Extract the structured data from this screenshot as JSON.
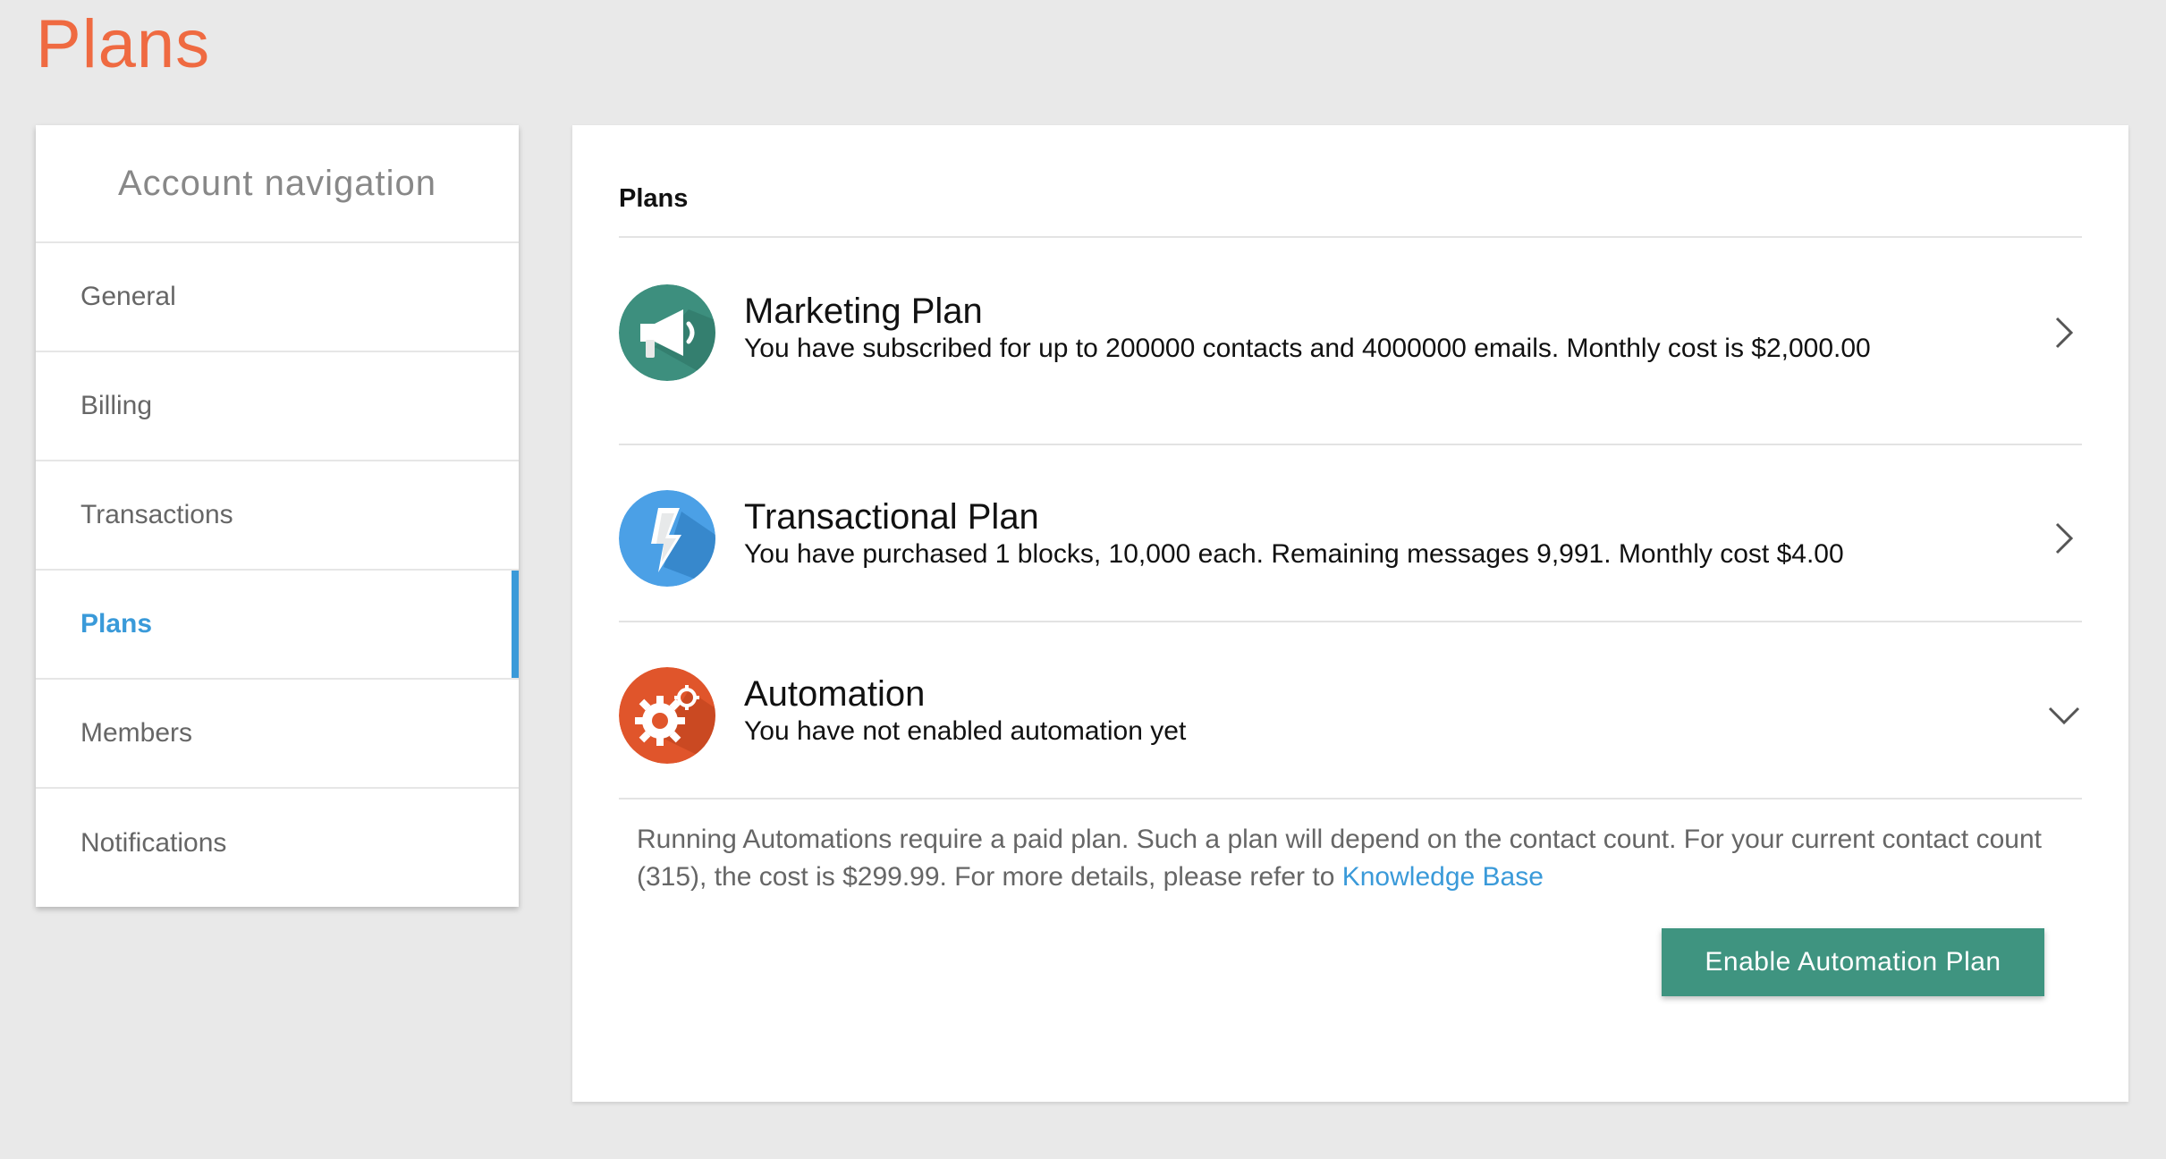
{
  "page": {
    "title": "Plans"
  },
  "sidebar": {
    "header": "Account navigation",
    "items": [
      {
        "label": "General"
      },
      {
        "label": "Billing"
      },
      {
        "label": "Transactions"
      },
      {
        "label": "Plans",
        "active": true
      },
      {
        "label": "Members"
      },
      {
        "label": "Notifications"
      }
    ]
  },
  "main": {
    "section_title": "Plans",
    "plans": [
      {
        "name": "Marketing Plan",
        "description": "You have subscribed for up to 200000 contacts and 4000000 emails. Monthly cost is $2,000.00",
        "icon": "megaphone-icon",
        "color": "#3d8f7e"
      },
      {
        "name": "Transactional Plan",
        "description": "You have purchased 1 blocks, 10,000 each. Remaining messages 9,991. Monthly cost $4.00",
        "icon": "lightning-icon",
        "color": "#4ba0e6"
      },
      {
        "name": "Automation",
        "description": "You have not enabled automation yet",
        "icon": "gears-icon",
        "color": "#e0552b"
      }
    ],
    "automation_note": {
      "text": "Running Automations require a paid plan. Such a plan will depend on the contact count. For your current contact count (315), the cost is $299.99. For more details, please refer to ",
      "link_label": "Knowledge Base"
    },
    "enable_button_label": "Enable Automation Plan"
  },
  "colors": {
    "accent_orange": "#ef6a41",
    "active_blue": "#3a9ad9",
    "button_green": "#3f9480"
  }
}
